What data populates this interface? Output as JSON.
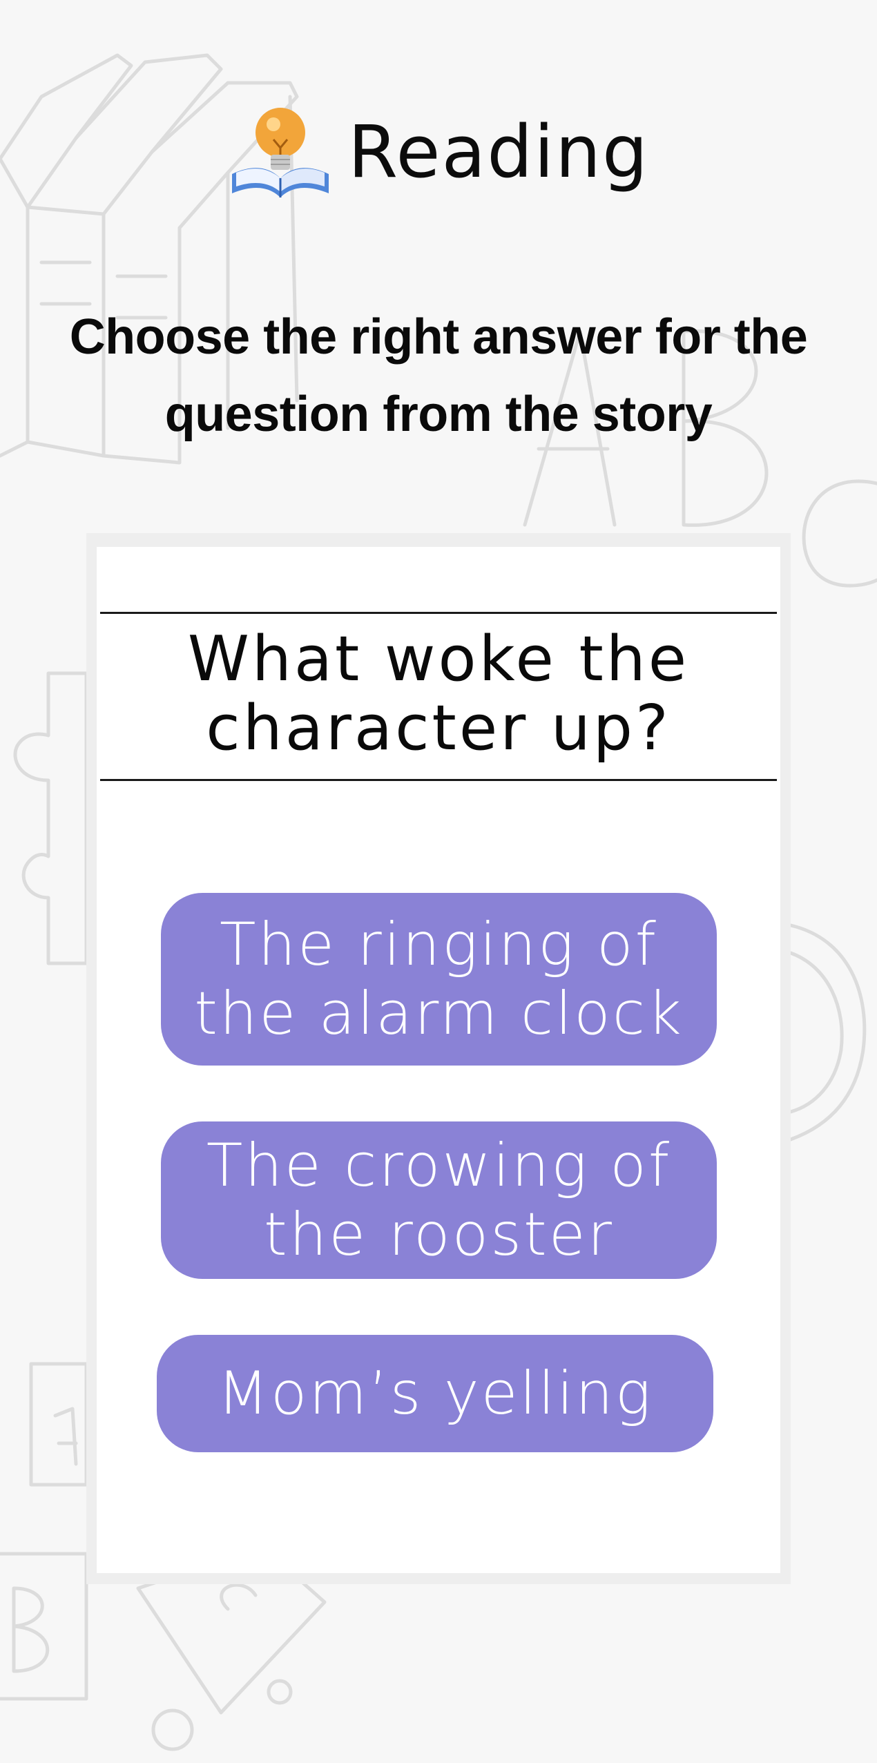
{
  "header": {
    "icon": "book-lightbulb-icon",
    "title": "Reading"
  },
  "instruction": "Choose the right answer for the question from the story",
  "question": "What woke the character up?",
  "answers": [
    {
      "label": "The ringing of the alarm clock"
    },
    {
      "label": "The crowing of the rooster"
    },
    {
      "label": "Mom’s yelling"
    }
  ],
  "colors": {
    "background": "#f7f7f7",
    "card": "#ffffff",
    "answer_button": "#8a82d6",
    "answer_text": "#ffffff",
    "text": "#0a0a0a"
  }
}
